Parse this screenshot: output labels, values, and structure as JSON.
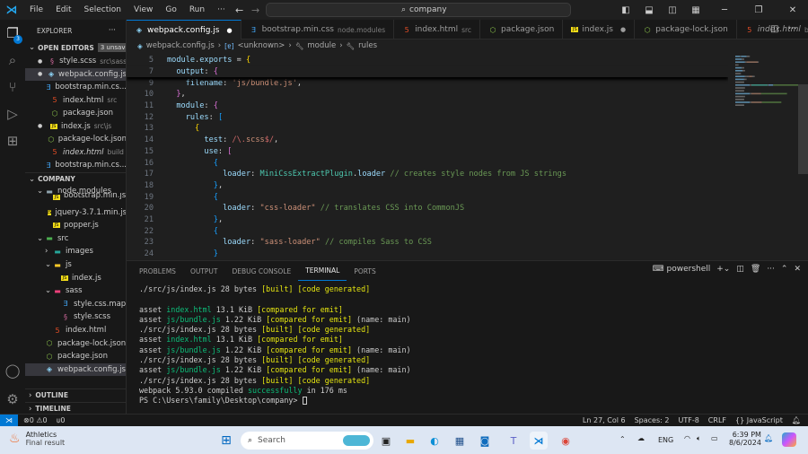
{
  "titlebar": {
    "menus": [
      "File",
      "Edit",
      "Selection",
      "View",
      "Go",
      "Run",
      "···"
    ],
    "search": "company"
  },
  "activity": {
    "badge": "3"
  },
  "sidebar": {
    "title": "EXPLORER",
    "open_editors": "OPEN EDITORS",
    "unsaved": "3 unsaved",
    "open": [
      {
        "name": "style.scss",
        "desc": "src\\sass",
        "icon": "sass",
        "dot": true
      },
      {
        "name": "webpack.config.js",
        "desc": "",
        "icon": "webpack",
        "dot": true,
        "sel": true
      },
      {
        "name": "bootstrap.min.cs...",
        "desc": "",
        "icon": "css"
      },
      {
        "name": "index.html",
        "desc": "src",
        "icon": "html"
      },
      {
        "name": "package.json",
        "desc": "",
        "icon": "node"
      },
      {
        "name": "index.js",
        "desc": "src\\js",
        "icon": "js",
        "dot": true
      },
      {
        "name": "package-lock.json",
        "desc": "",
        "icon": "node"
      },
      {
        "name": "index.html",
        "desc": "build",
        "icon": "html",
        "italic": true
      },
      {
        "name": "bootstrap.min.cs...",
        "desc": "",
        "icon": "css"
      }
    ],
    "project": "COMPANY",
    "tree": [
      {
        "name": "node.modules",
        "depth": 1,
        "icon": "folder",
        "chev": "v"
      },
      {
        "name": "bootstrap.min.js",
        "depth": 2,
        "icon": "js"
      },
      {
        "name": "jquery-3.7.1.min.js",
        "depth": 2,
        "icon": "js"
      },
      {
        "name": "popper.js",
        "depth": 2,
        "icon": "js"
      },
      {
        "name": "src",
        "depth": 1,
        "icon": "folder-src",
        "chev": "v"
      },
      {
        "name": "images",
        "depth": 2,
        "icon": "folder-images",
        "chev": ">"
      },
      {
        "name": "js",
        "depth": 2,
        "icon": "folder-js",
        "chev": "v"
      },
      {
        "name": "index.js",
        "depth": 3,
        "icon": "js"
      },
      {
        "name": "sass",
        "depth": 2,
        "icon": "folder-sass",
        "chev": "v"
      },
      {
        "name": "style.css.map",
        "depth": 3,
        "icon": "css"
      },
      {
        "name": "style.scss",
        "depth": 3,
        "icon": "sass"
      },
      {
        "name": "index.html",
        "depth": 2,
        "icon": "html"
      },
      {
        "name": "package-lock.json",
        "depth": 1,
        "icon": "node"
      },
      {
        "name": "package.json",
        "depth": 1,
        "icon": "node"
      },
      {
        "name": "webpack.config.js",
        "depth": 1,
        "icon": "webpack",
        "sel": true
      }
    ],
    "outline": "OUTLINE",
    "timeline": "TIMELINE"
  },
  "tabs": [
    {
      "name": "webpack.config.js",
      "desc": "",
      "icon": "webpack",
      "active": true,
      "dot": true
    },
    {
      "name": "bootstrap.min.css",
      "desc": "node.modules",
      "icon": "css"
    },
    {
      "name": "index.html",
      "desc": "src",
      "icon": "html"
    },
    {
      "name": "package.json",
      "desc": "",
      "icon": "node"
    },
    {
      "name": "index.js",
      "desc": "",
      "icon": "js",
      "dot": true
    },
    {
      "name": "package-lock.json",
      "desc": "",
      "icon": "node"
    },
    {
      "name": "index.html",
      "desc": "build",
      "icon": "html",
      "italic": true
    }
  ],
  "breadcrumb": [
    "webpack.config.js",
    "<unknown>",
    "module",
    "rules"
  ],
  "code": [
    {
      "n": "5",
      "sticky": true,
      "tokens": [
        [
          "module",
          "k"
        ],
        [
          ".",
          "d"
        ],
        [
          "exports",
          "k"
        ],
        [
          " = ",
          "d"
        ],
        [
          "{",
          "p"
        ]
      ]
    },
    {
      "n": "7",
      "sticky": true,
      "tokens": [
        [
          "  output",
          "k"
        ],
        [
          ": ",
          "d"
        ],
        [
          "{",
          "m"
        ]
      ]
    },
    {
      "n": "9",
      "tokens": [
        [
          "    filename",
          "k"
        ],
        [
          ": ",
          "d"
        ],
        [
          "'js/bundle.js'",
          "s"
        ],
        [
          ",",
          "d"
        ]
      ]
    },
    {
      "n": "10",
      "tokens": [
        [
          "  ",
          "d"
        ],
        [
          "}",
          "m"
        ],
        [
          ",",
          "d"
        ]
      ]
    },
    {
      "n": "11",
      "tokens": [
        [
          "  module",
          "k"
        ],
        [
          ": ",
          "d"
        ],
        [
          "{",
          "m"
        ]
      ]
    },
    {
      "n": "12",
      "tokens": [
        [
          "    rules",
          "k"
        ],
        [
          ": ",
          "d"
        ],
        [
          "[",
          "b"
        ]
      ]
    },
    {
      "n": "13",
      "tokens": [
        [
          "      ",
          "d"
        ],
        [
          "{",
          "p"
        ]
      ]
    },
    {
      "n": "14",
      "tokens": [
        [
          "        test",
          "k"
        ],
        [
          ": ",
          "d"
        ],
        [
          "/\\.",
          "r"
        ],
        [
          "scss",
          "s"
        ],
        [
          "$/",
          "r"
        ],
        [
          ",",
          "d"
        ]
      ]
    },
    {
      "n": "15",
      "tokens": [
        [
          "        use",
          "k"
        ],
        [
          ": ",
          "d"
        ],
        [
          "[",
          "m"
        ]
      ]
    },
    {
      "n": "16",
      "tokens": [
        [
          "          ",
          "d"
        ],
        [
          "{",
          "b"
        ]
      ]
    },
    {
      "n": "17",
      "tokens": [
        [
          "            loader",
          "k"
        ],
        [
          ": ",
          "d"
        ],
        [
          "MiniCssExtractPlugin",
          "t"
        ],
        [
          ".",
          "d"
        ],
        [
          "loader",
          "k"
        ],
        [
          " // creates style nodes from JS strings",
          "c"
        ]
      ]
    },
    {
      "n": "18",
      "tokens": [
        [
          "          ",
          "d"
        ],
        [
          "}",
          "b"
        ],
        [
          ",",
          "d"
        ]
      ]
    },
    {
      "n": "19",
      "tokens": [
        [
          "          ",
          "d"
        ],
        [
          "{",
          "b"
        ]
      ]
    },
    {
      "n": "20",
      "tokens": [
        [
          "            loader",
          "k"
        ],
        [
          ": ",
          "d"
        ],
        [
          "\"css-loader\"",
          "s"
        ],
        [
          " // translates CSS into CommonJS",
          "c"
        ]
      ]
    },
    {
      "n": "21",
      "tokens": [
        [
          "          ",
          "d"
        ],
        [
          "}",
          "b"
        ],
        [
          ",",
          "d"
        ]
      ]
    },
    {
      "n": "22",
      "tokens": [
        [
          "          ",
          "d"
        ],
        [
          "{",
          "b"
        ]
      ]
    },
    {
      "n": "23",
      "tokens": [
        [
          "            loader",
          "k"
        ],
        [
          ": ",
          "d"
        ],
        [
          "\"sass-loader\"",
          "s"
        ],
        [
          " // compiles Sass to CSS",
          "c"
        ]
      ]
    },
    {
      "n": "24",
      "tokens": [
        [
          "          ",
          "d"
        ],
        [
          "}",
          "b"
        ]
      ]
    }
  ],
  "panel": {
    "tabs": [
      "PROBLEMS",
      "OUTPUT",
      "DEBUG CONSOLE",
      "TERMINAL",
      "PORTS"
    ],
    "active": "TERMINAL",
    "shell": "powershell"
  },
  "terminal": [
    [
      [
        "./src/js/index.js 28 bytes ",
        ""
      ],
      [
        "[built] [code generated]",
        "ty"
      ]
    ],
    [],
    [
      [
        "asset ",
        ""
      ],
      [
        "index.html",
        "tg"
      ],
      [
        " 13.1 KiB ",
        ""
      ],
      [
        "[compared for emit]",
        "ty"
      ]
    ],
    [
      [
        "asset ",
        ""
      ],
      [
        "js/bundle.js",
        "tg"
      ],
      [
        " 1.22 KiB ",
        ""
      ],
      [
        "[compared for emit]",
        "ty"
      ],
      [
        " (name: main)",
        ""
      ]
    ],
    [
      [
        "./src/js/index.js 28 bytes ",
        ""
      ],
      [
        "[built] [code generated]",
        "ty"
      ]
    ],
    [
      [
        "asset ",
        ""
      ],
      [
        "index.html",
        "tg"
      ],
      [
        " 13.1 KiB ",
        ""
      ],
      [
        "[compared for emit]",
        "ty"
      ]
    ],
    [
      [
        "asset ",
        ""
      ],
      [
        "js/bundle.js",
        "tg"
      ],
      [
        " 1.22 KiB ",
        ""
      ],
      [
        "[compared for emit]",
        "ty"
      ],
      [
        " (name: main)",
        ""
      ]
    ],
    [
      [
        "./src/js/index.js 28 bytes ",
        ""
      ],
      [
        "[built] [code generated]",
        "ty"
      ]
    ],
    [
      [
        "asset ",
        ""
      ],
      [
        "js/bundle.js",
        "tg"
      ],
      [
        " 1.22 KiB ",
        ""
      ],
      [
        "[compared for emit]",
        "ty"
      ],
      [
        " (name: main)",
        ""
      ]
    ],
    [
      [
        "./src/js/index.js 28 bytes ",
        ""
      ],
      [
        "[built] [code generated]",
        "ty"
      ]
    ],
    [
      [
        "webpack 5.93.0 compiled ",
        ""
      ],
      [
        "successfully",
        "tg"
      ],
      [
        " in 176 ms",
        ""
      ]
    ],
    [
      [
        "PS C:\\Users\\family\\Desktop\\company> ",
        ""
      ]
    ]
  ],
  "status": {
    "errors": "0",
    "warnings": "0",
    "ports": "0",
    "position": "Ln 27, Col 6",
    "spaces": "Spaces: 2",
    "encoding": "UTF-8",
    "eol": "CRLF",
    "language": "JavaScript"
  },
  "taskbar": {
    "widget_title": "Athletics",
    "widget_sub": "Final result",
    "search": "Search",
    "lang": "ENG",
    "time": "6:39 PM",
    "date": "8/6/2024"
  },
  "colors": {
    "accent": "#0078d4",
    "background": "#1f1f1f",
    "sidebar": "#181818"
  }
}
